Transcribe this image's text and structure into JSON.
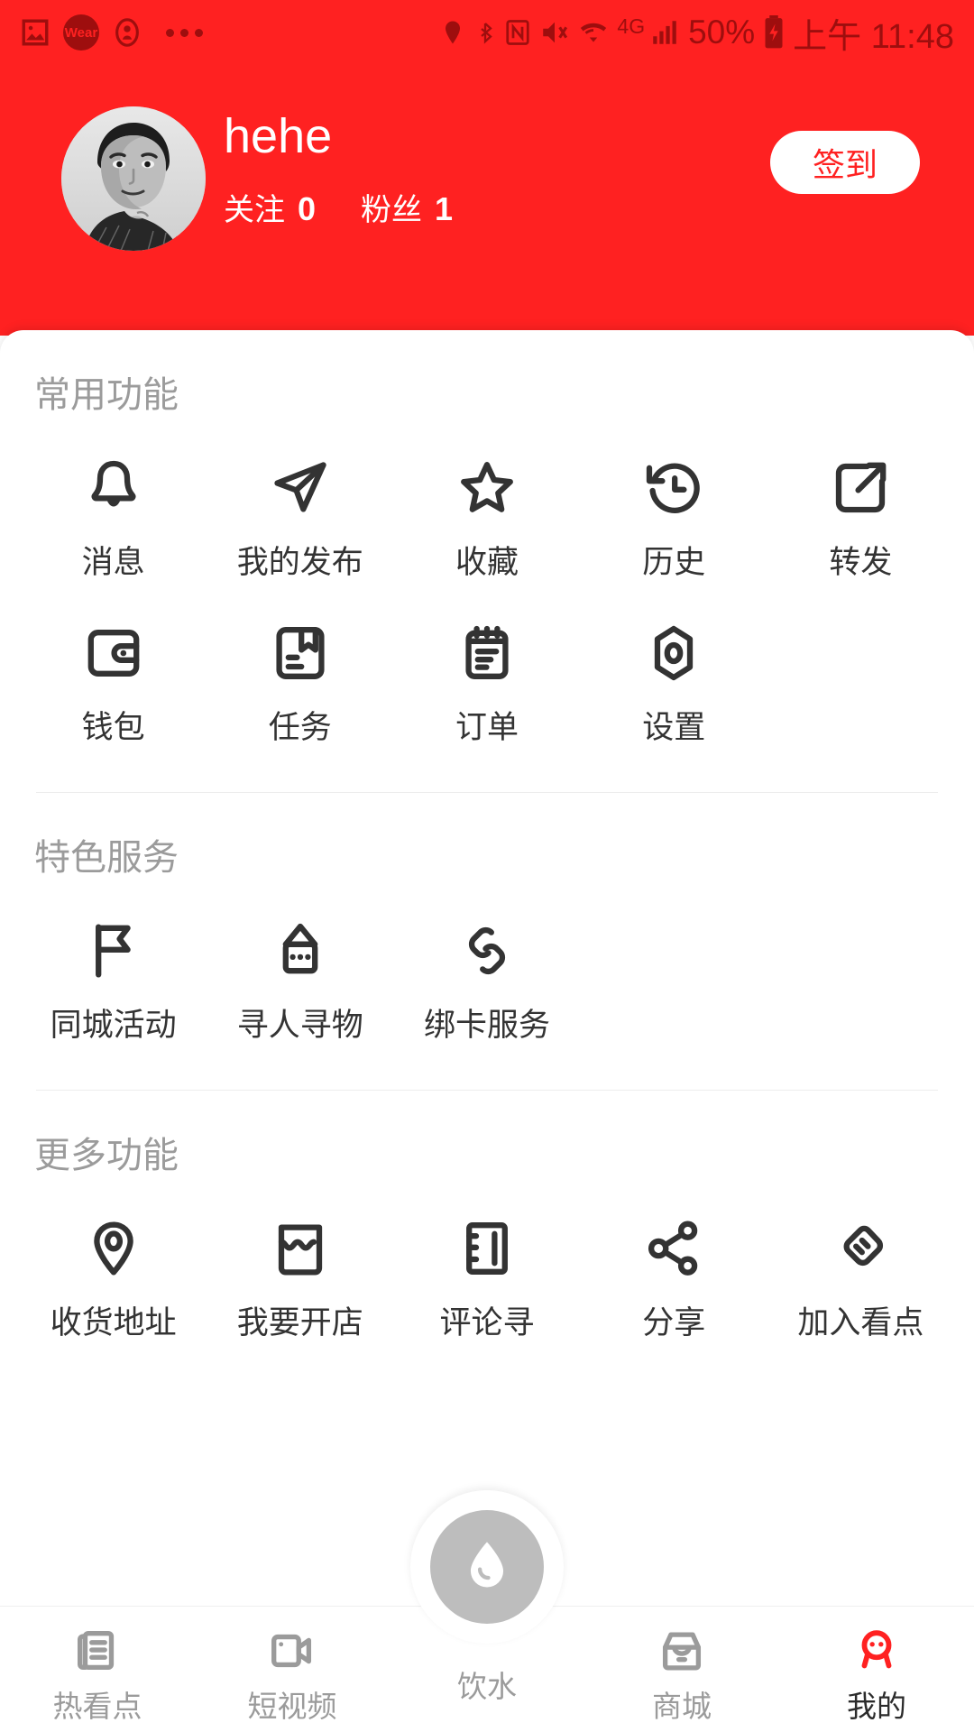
{
  "statusbar": {
    "time": "上午 11:48",
    "battery_percent": "50%",
    "network": "4G",
    "wear_badge": "Wear",
    "icons_left": [
      "image-icon",
      "wear-icon",
      "account-icon",
      "more-dots-icon"
    ],
    "icons_right": [
      "location-icon",
      "bluetooth-icon",
      "nfc-icon",
      "mute-vibrate-icon",
      "wifi-icon",
      "signal-4g-icon",
      "battery-charging-icon"
    ]
  },
  "header": {
    "username": "hehe",
    "following_label": "关注",
    "following_count": "0",
    "followers_label": "粉丝",
    "followers_count": "1",
    "signin_label": "签到",
    "bg_color": "#FF2121",
    "avatar_name": "user-avatar"
  },
  "sections": [
    {
      "title": "常用功能",
      "items": [
        {
          "label": "消息",
          "icon": "bell-icon"
        },
        {
          "label": "我的发布",
          "icon": "paper-plane-icon"
        },
        {
          "label": "收藏",
          "icon": "star-icon"
        },
        {
          "label": "历史",
          "icon": "history-clock-icon"
        },
        {
          "label": "转发",
          "icon": "share-external-icon"
        },
        {
          "label": "钱包",
          "icon": "wallet-icon"
        },
        {
          "label": "任务",
          "icon": "bookmark-task-icon"
        },
        {
          "label": "订单",
          "icon": "clipboard-order-icon"
        },
        {
          "label": "设置",
          "icon": "hexagon-settings-icon"
        }
      ]
    },
    {
      "title": "特色服务",
      "items": [
        {
          "label": "同城活动",
          "icon": "flag-icon"
        },
        {
          "label": "寻人寻物",
          "icon": "notice-box-icon"
        },
        {
          "label": "绑卡服务",
          "icon": "chain-link-icon"
        }
      ]
    },
    {
      "title": "更多功能",
      "items": [
        {
          "label": "收货地址",
          "icon": "location-pin-icon"
        },
        {
          "label": "我要开店",
          "icon": "storefront-icon"
        },
        {
          "label": "评论寻",
          "icon": "ruler-book-icon"
        },
        {
          "label": "分享",
          "icon": "share-nodes-icon"
        },
        {
          "label": "加入看点",
          "icon": "handshake-icon"
        }
      ]
    }
  ],
  "tabbar": {
    "items": [
      {
        "label": "热看点",
        "icon": "news-document-icon",
        "active": false
      },
      {
        "label": "短视频",
        "icon": "video-camera-icon",
        "active": false
      },
      {
        "label": "商城",
        "icon": "store-icon",
        "active": false
      },
      {
        "label": "我的",
        "icon": "person-avatar-icon",
        "active": true
      }
    ],
    "center": {
      "label": "饮水",
      "icon": "water-drop-icon"
    },
    "active_color": "#FF2121",
    "inactive_color": "#9B9B9B"
  }
}
